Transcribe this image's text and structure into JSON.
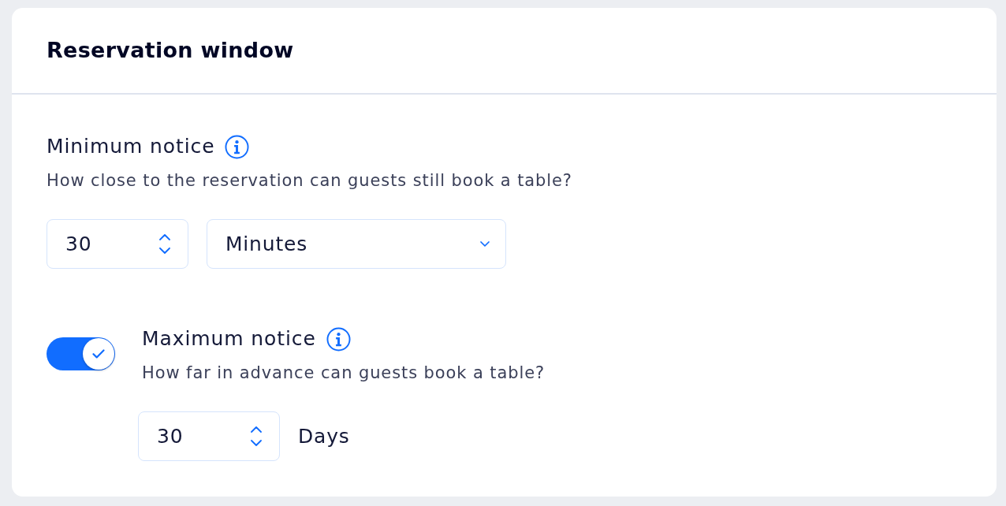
{
  "section": {
    "title": "Reservation window"
  },
  "minimum_notice": {
    "label": "Minimum notice",
    "description": "How close to the reservation can guests still book a table?",
    "value": "30",
    "unit": "Minutes"
  },
  "maximum_notice": {
    "on": true,
    "label": "Maximum notice",
    "description": "How far in advance can guests book a table?",
    "value": "30",
    "unit": "Days"
  }
}
